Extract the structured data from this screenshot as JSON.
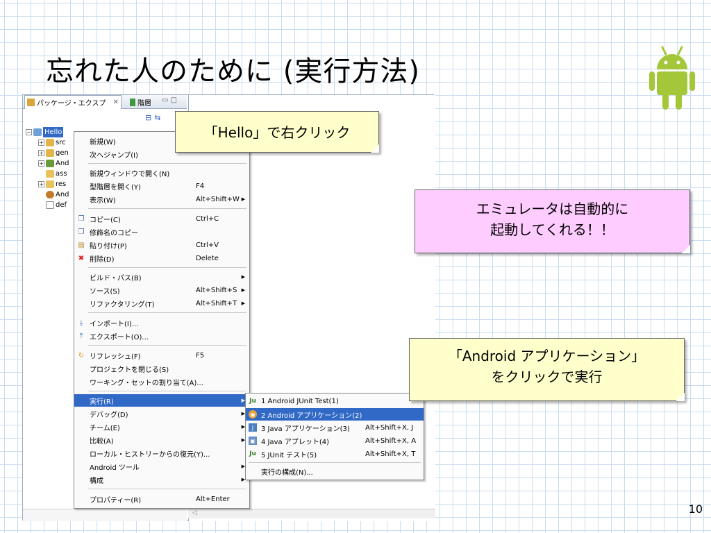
{
  "slide": {
    "title": "忘れた人のために (実行方法)",
    "page_number": "10"
  },
  "eclipse": {
    "tab_active_label": "パッケージ・エクスプ",
    "tab_inactive_label": "階層",
    "tree": {
      "root": "Hello",
      "children": [
        "src",
        "gen",
        "And",
        "ass",
        "res",
        "And",
        "def"
      ]
    }
  },
  "context_menu": {
    "items": [
      {
        "label": "新規(W)",
        "shortcut": "",
        "arrow": "▶"
      },
      {
        "label": "次へジャンプ(I)",
        "shortcut": "",
        "arrow": ""
      },
      {
        "label": "新規ウィンドウで開く(N)",
        "shortcut": "",
        "arrow": ""
      },
      {
        "label": "型階層を開く(Y)",
        "shortcut": "F4",
        "arrow": ""
      },
      {
        "label": "表示(W)",
        "shortcut": "Alt+Shift+W",
        "arrow": "▶"
      },
      {
        "label": "コピー(C)",
        "shortcut": "Ctrl+C",
        "arrow": ""
      },
      {
        "label": "修飾名のコピー",
        "shortcut": "",
        "arrow": ""
      },
      {
        "label": "貼り付け(P)",
        "shortcut": "Ctrl+V",
        "arrow": ""
      },
      {
        "label": "削除(D)",
        "shortcut": "Delete",
        "arrow": ""
      },
      {
        "label": "ビルド・パス(B)",
        "shortcut": "",
        "arrow": "▶"
      },
      {
        "label": "ソース(S)",
        "shortcut": "Alt+Shift+S",
        "arrow": "▶"
      },
      {
        "label": "リファクタリング(T)",
        "shortcut": "Alt+Shift+T",
        "arrow": "▶"
      },
      {
        "label": "インポート(I)...",
        "shortcut": "",
        "arrow": ""
      },
      {
        "label": "エクスポート(O)...",
        "shortcut": "",
        "arrow": ""
      },
      {
        "label": "リフレッシュ(F)",
        "shortcut": "F5",
        "arrow": ""
      },
      {
        "label": "プロジェクトを閉じる(S)",
        "shortcut": "",
        "arrow": ""
      },
      {
        "label": "ワーキング・セットの割り当て(A)...",
        "shortcut": "",
        "arrow": ""
      },
      {
        "label": "実行(R)",
        "shortcut": "",
        "arrow": "▶"
      },
      {
        "label": "デバッグ(D)",
        "shortcut": "",
        "arrow": "▶"
      },
      {
        "label": "チーム(E)",
        "shortcut": "",
        "arrow": "▶"
      },
      {
        "label": "比較(A)",
        "shortcut": "",
        "arrow": "▶"
      },
      {
        "label": "ローカル・ヒストリーからの復元(Y)...",
        "shortcut": "",
        "arrow": ""
      },
      {
        "label": "Android ツール",
        "shortcut": "",
        "arrow": "▶"
      },
      {
        "label": "構成",
        "shortcut": "",
        "arrow": "▶"
      },
      {
        "label": "プロパティー(R)",
        "shortcut": "Alt+Enter",
        "arrow": ""
      }
    ]
  },
  "submenu": {
    "items": [
      {
        "label": "1 Android JUnit Test(1)",
        "shortcut": ""
      },
      {
        "label": "2 Android アプリケーション(2)",
        "shortcut": ""
      },
      {
        "label": "3 Java アプリケーション(3)",
        "shortcut": "Alt+Shift+X, J"
      },
      {
        "label": "4 Java アプレット(4)",
        "shortcut": "Alt+Shift+X, A"
      },
      {
        "label": "5 JUnit テスト(5)",
        "shortcut": "Alt+Shift+X, T"
      },
      {
        "label": "実行の構成(N)...",
        "shortcut": ""
      }
    ]
  },
  "callouts": {
    "hello": "「Hello」で右クリック",
    "emulator_line1": "エミュレータは自動的に",
    "emulator_line2": "起動してくれる！！",
    "android_line1": "「Android アプリケーション」",
    "android_line2": "をクリックで実行"
  },
  "colors": {
    "selection": "#3169c6",
    "android_green": "#a4c639",
    "callout_yellow": "#ffffcc",
    "callout_pink": "#ffccff"
  }
}
